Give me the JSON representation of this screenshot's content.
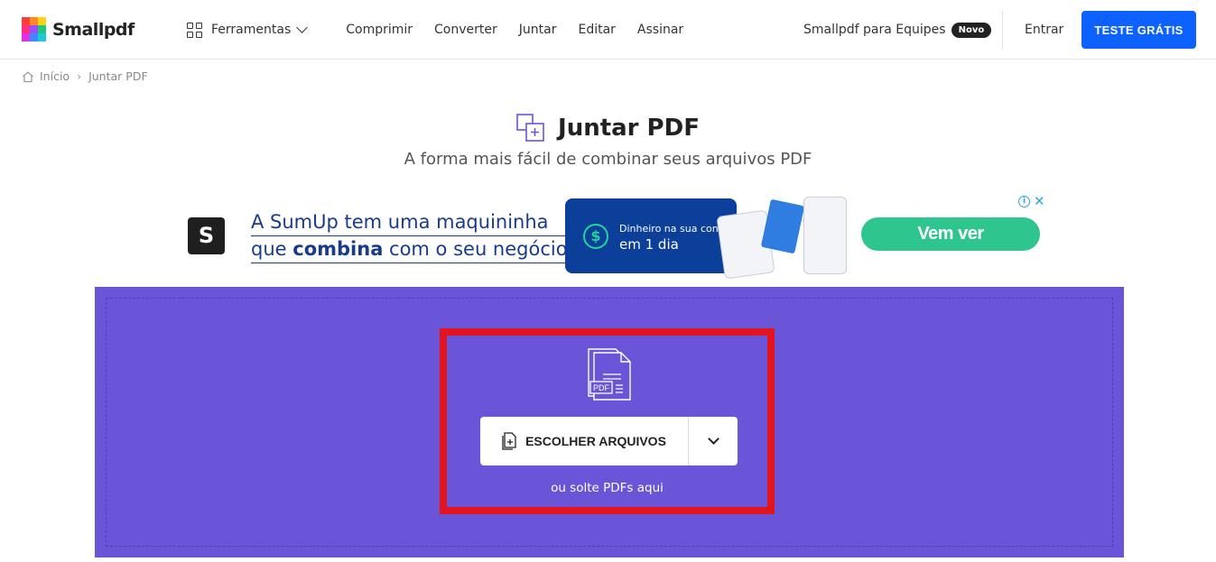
{
  "header": {
    "logo_text": "Smallpdf",
    "tools_label": "Ferramentas",
    "nav_links": [
      "Comprimir",
      "Converter",
      "Juntar",
      "Editar",
      "Assinar"
    ],
    "teams_label": "Smallpdf para Equipes",
    "teams_badge": "Novo",
    "login_label": "Entrar",
    "trial_label": "TESTE GRÁTIS"
  },
  "breadcrumb": {
    "home": "Início",
    "separator": "›",
    "current": "Juntar PDF"
  },
  "page": {
    "title": "Juntar PDF",
    "subtitle": "A forma mais fácil de combinar seus arquivos PDF"
  },
  "ad": {
    "logo_letter": "S",
    "line1": "A SumUp tem uma maquininha",
    "line2_pre": "que ",
    "line2_bold": "combina",
    "line2_post": " com o seu negócio.",
    "banner_small": "Dinheiro na sua conta",
    "banner_big": "em 1 dia",
    "banner_symbol": "$",
    "cta": "Vem ver",
    "info_symbol": "i",
    "close_symbol": "✕"
  },
  "upload": {
    "choose_label": "ESCOLHER ARQUIVOS",
    "drop_hint": "ou solte PDFs aqui",
    "pdf_badge": "PDF"
  },
  "colors": {
    "brand_blue": "#0d62ff",
    "dropzone": "#6a55d9",
    "highlight": "#e3141e",
    "ad_green": "#2ec68e",
    "ad_navy": "#0b3f9a"
  }
}
